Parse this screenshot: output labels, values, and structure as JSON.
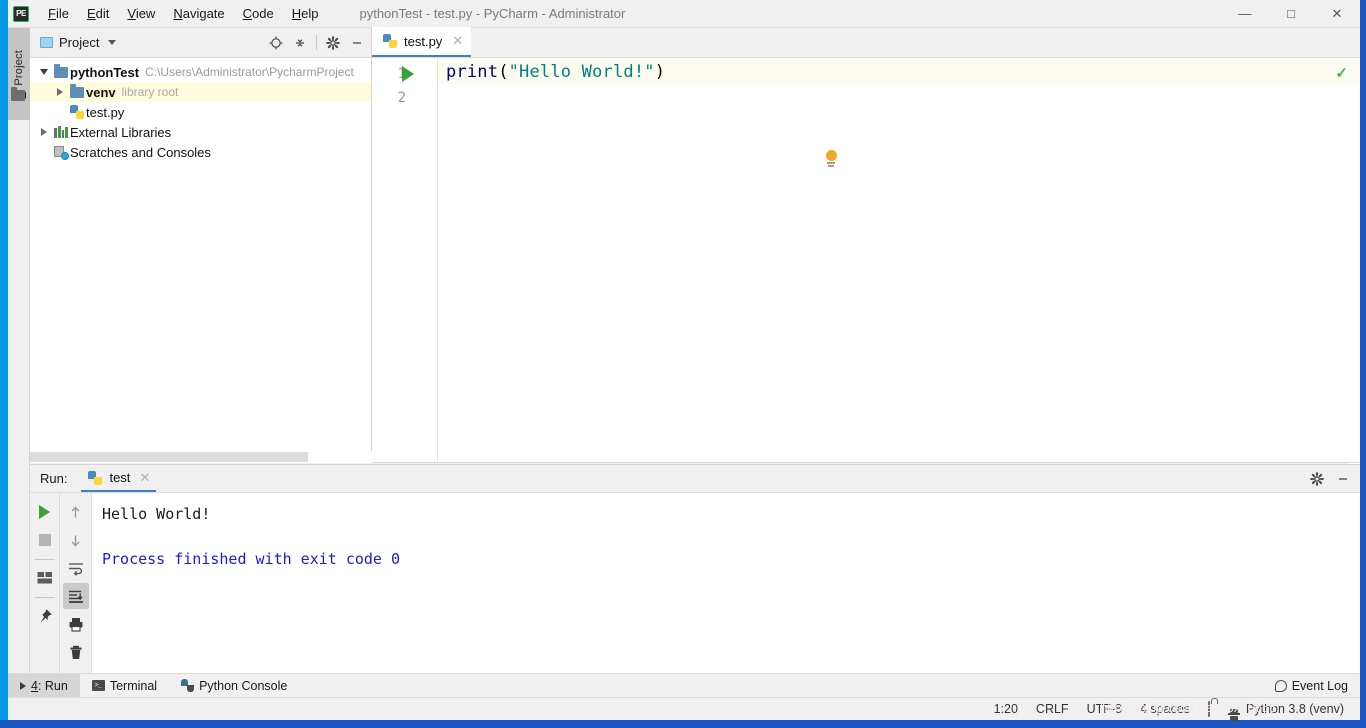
{
  "window": {
    "title": "pythonTest - test.py - PyCharm - Administrator",
    "logo_text": "PE",
    "minimize_label": "—",
    "maximize_label": "□",
    "close_label": "✕"
  },
  "menu": {
    "items": [
      {
        "label": "File",
        "mnemonic": "F"
      },
      {
        "label": "Edit",
        "mnemonic": "E"
      },
      {
        "label": "View",
        "mnemonic": "V"
      },
      {
        "label": "Navigate",
        "mnemonic": "N"
      },
      {
        "label": "Code",
        "mnemonic": "C"
      },
      {
        "label": "Help",
        "mnemonic": "H"
      }
    ]
  },
  "left_strip": {
    "tab_label": "1: Project",
    "tab_icon": "folder-icon"
  },
  "project_panel": {
    "title": "Project",
    "dropdown_icon": "chevron-down-icon",
    "tools": [
      {
        "name": "locate-icon",
        "glyph": "⊕"
      },
      {
        "name": "collapse-all-icon",
        "glyph": "≒"
      },
      {
        "name": "settings-gear-icon",
        "glyph": "⚙"
      },
      {
        "name": "hide-panel-icon",
        "glyph": "—"
      }
    ],
    "tree": [
      {
        "name": "pythonTest",
        "sub": "C:\\Users\\Administrator\\PycharmProject",
        "icon": "folder-icon",
        "twisty": "down",
        "bold": true,
        "indent": 0,
        "highlight": false
      },
      {
        "name": "venv",
        "sub": "library root",
        "icon": "folder-icon",
        "twisty": "right",
        "bold": false,
        "indent": 1,
        "highlight": true
      },
      {
        "name": "test.py",
        "sub": "",
        "icon": "python-file-icon",
        "twisty": "none",
        "bold": false,
        "indent": 1,
        "highlight": false
      },
      {
        "name": "External Libraries",
        "sub": "",
        "icon": "libraries-icon",
        "twisty": "right",
        "bold": false,
        "indent": 0,
        "highlight": false
      },
      {
        "name": "Scratches and Consoles",
        "sub": "",
        "icon": "scratches-icon",
        "twisty": "none",
        "bold": false,
        "indent": 0,
        "highlight": false
      }
    ]
  },
  "editor": {
    "tab": {
      "label": "test.py",
      "icon": "python-file-icon",
      "close_glyph": "✕"
    },
    "gutter": {
      "line1": "1",
      "line2": "2",
      "run_icon": "run-gutter-icon"
    },
    "code": {
      "func": "print",
      "open_paren": "(",
      "string": "\"Hello World!\"",
      "close_paren": ")"
    },
    "intention_icon": "lightbulb-icon",
    "inspection_status": "✓"
  },
  "run_panel": {
    "label": "Run:",
    "tab_label": "test",
    "tab_icon": "python-file-icon",
    "tab_close": "✕",
    "header_tools": [
      {
        "name": "settings-gear-icon",
        "glyph": "⚙"
      },
      {
        "name": "hide-panel-icon",
        "glyph": "—"
      }
    ],
    "left_toolbar": [
      {
        "name": "rerun-button",
        "glyph": ""
      },
      {
        "name": "stop-button",
        "glyph": ""
      },
      {
        "name": "layout-button",
        "glyph": ""
      },
      {
        "name": "pin-tab-button",
        "glyph": "📌"
      }
    ],
    "second_toolbar": [
      {
        "name": "up-arrow-button",
        "glyph": "↑"
      },
      {
        "name": "down-arrow-button",
        "glyph": "↓"
      },
      {
        "name": "soft-wrap-button",
        "glyph": "↩"
      },
      {
        "name": "scroll-to-end-button",
        "glyph": "⤓"
      },
      {
        "name": "print-button",
        "glyph": "⎙"
      },
      {
        "name": "clear-all-button",
        "glyph": "🗑"
      }
    ],
    "console_lines": [
      {
        "text": "Hello World!",
        "color": "black"
      },
      {
        "text": "",
        "color": "black"
      },
      {
        "text": "Process finished with exit code 0",
        "color": "blue"
      }
    ]
  },
  "bottom_bar": {
    "items": [
      {
        "label": "4: Run",
        "mnemonic": "4",
        "icon": "run-triangle-icon",
        "active": true
      },
      {
        "label": "Terminal",
        "mnemonic": "",
        "icon": "terminal-icon",
        "active": false
      },
      {
        "label": "Python Console",
        "mnemonic": "",
        "icon": "python-console-icon",
        "active": false
      }
    ],
    "event_log": {
      "label": "Event Log",
      "icon": "event-log-icon"
    }
  },
  "status_bar": {
    "caret": "1:20",
    "line_separator": "CRLF",
    "encoding": "UTF-8",
    "indent": "4 spaces",
    "lock_icon": "lock-icon",
    "git_icon": "git-branch-icon",
    "interpreter": "Python 3.8 (venv)"
  },
  "colors": {
    "accent_left": "#0098e3",
    "accent_bottom": "#1a56c4",
    "keyword": "#000080",
    "string": "#008080",
    "console_blue": "#1a1ae0",
    "run_green": "#3aa03a",
    "highlight_row": "#fdfbdb",
    "current_line": "#fcfbef"
  },
  "watermark": {
    "text": "https://blog.csdn.net/x6x66666"
  }
}
